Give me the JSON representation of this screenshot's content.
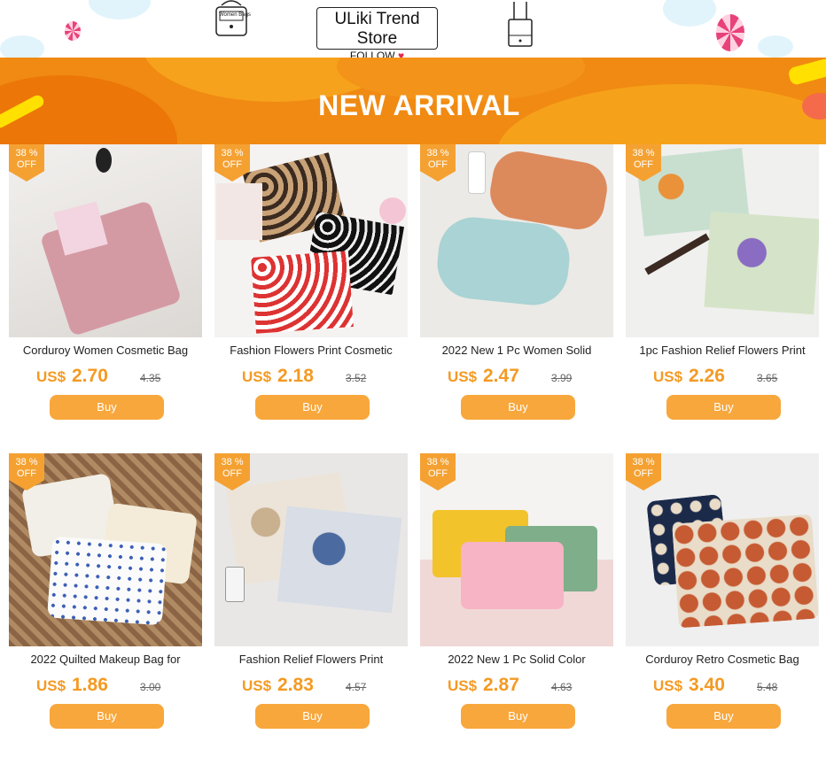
{
  "header": {
    "store_name": "ULiki Trend Store",
    "follow_label": "FOLLOW",
    "bag_tag_label": "Women Bags"
  },
  "banner": {
    "title": "NEW ARRIVAL"
  },
  "colors": {
    "banner_orange": "#f08a12",
    "price_orange": "#f49a23",
    "buy_button": "#f8a73c",
    "badge": "#f4a132"
  },
  "products": [
    {
      "badge_pct": "38 %",
      "badge_off": "OFF",
      "title": "Corduroy Women Cosmetic Bag",
      "currency": "US$",
      "price": "2.70",
      "original": "4.35",
      "buy_label": "Buy"
    },
    {
      "badge_pct": "38 %",
      "badge_off": "OFF",
      "title": "Fashion Flowers Print Cosmetic",
      "currency": "US$",
      "price": "2.18",
      "original": "3.52",
      "buy_label": "Buy"
    },
    {
      "badge_pct": "38 %",
      "badge_off": "OFF",
      "title": "2022 New 1 Pc Women Solid",
      "currency": "US$",
      "price": "2.47",
      "original": "3.99",
      "buy_label": "Buy"
    },
    {
      "badge_pct": "38 %",
      "badge_off": "OFF",
      "title": "1pc Fashion Relief Flowers Print",
      "currency": "US$",
      "price": "2.26",
      "original": "3.65",
      "buy_label": "Buy"
    },
    {
      "badge_pct": "38 %",
      "badge_off": "OFF",
      "title": "2022 Quilted Makeup Bag for",
      "currency": "US$",
      "price": "1.86",
      "original": "3.00",
      "buy_label": "Buy"
    },
    {
      "badge_pct": "38 %",
      "badge_off": "OFF",
      "title": "Fashion Relief Flowers Print",
      "currency": "US$",
      "price": "2.83",
      "original": "4.57",
      "buy_label": "Buy"
    },
    {
      "badge_pct": "38 %",
      "badge_off": "OFF",
      "title": "2022 New 1 Pc Solid Color",
      "currency": "US$",
      "price": "2.87",
      "original": "4.63",
      "buy_label": "Buy"
    },
    {
      "badge_pct": "38 %",
      "badge_off": "OFF",
      "title": "Corduroy Retro Cosmetic Bag",
      "currency": "US$",
      "price": "3.40",
      "original": "5.48",
      "buy_label": "Buy"
    }
  ]
}
